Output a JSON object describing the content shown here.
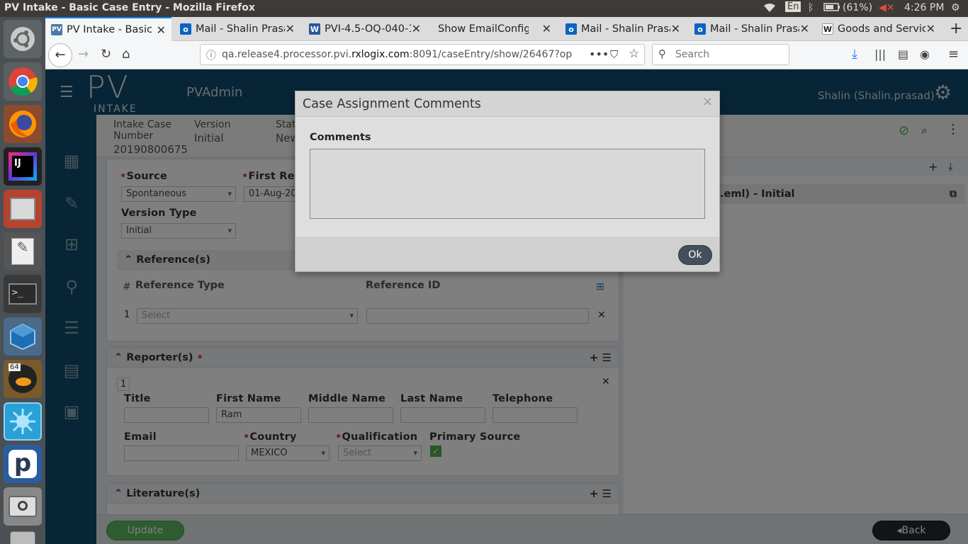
{
  "os": {
    "window_title": "PV Intake - Basic Case Entry - Mozilla Firefox",
    "keyboard": "En",
    "battery": "(61%)",
    "clock": "4:26 PM"
  },
  "launcher": {
    "items": [
      "ubuntu-home",
      "chrome",
      "firefox",
      "intellij",
      "file-manager",
      "text-editor",
      "terminal",
      "virtualbox",
      "game-64",
      "app-blue",
      "pidgin-p",
      "screenshot",
      "drive"
    ]
  },
  "browser": {
    "tabs": [
      {
        "label": "PV Intake - Basic C",
        "icon": "PV"
      },
      {
        "label": "Mail - Shalin Prasa",
        "icon": "o"
      },
      {
        "label": "PVI-4.5-OQ-040-1.",
        "icon": "W"
      },
      {
        "label": "Show EmailConfig",
        "icon": ""
      },
      {
        "label": "Mail - Shalin Prasa",
        "icon": "o"
      },
      {
        "label": "Mail - Shalin Prasa",
        "icon": "o"
      },
      {
        "label": "Goods and Servic",
        "icon": "W"
      }
    ],
    "url_prefix": "qa.release4.processor.pvi.",
    "url_domain": "rxlogix.com",
    "url_suffix": ":8091/caseEntry/show/26467?op",
    "search_placeholder": "Search"
  },
  "app": {
    "logo_big": "PV",
    "logo_small": "INTAKE",
    "module": "PVAdmin",
    "user": "Shalin (Shalin.prasad)",
    "case": {
      "number_label": "Intake Case Number",
      "number": "20190800675",
      "version_label": "Version",
      "version": "Initial",
      "status_label": "Stat",
      "status": "New"
    },
    "form": {
      "source_label": "Source",
      "source_value": "Spontaneous",
      "first_rec_label": "First Rec",
      "first_rec_value": "01-Aug-20",
      "version_type_label": "Version Type",
      "version_type_value": "Initial",
      "references": {
        "title": "Reference(s)",
        "col_hash": "#",
        "col_type": "Reference Type",
        "col_id": "Reference ID",
        "row_num": "1",
        "type_placeholder": "Select"
      },
      "reporters": {
        "title": "Reporter(s)",
        "row_num": "1",
        "title_label": "Title",
        "first_name_label": "First Name",
        "first_name": "Ram",
        "middle_name_label": "Middle Name",
        "last_name_label": "Last Name",
        "telephone_label": "Telephone",
        "email_label": "Email",
        "country_label": "Country",
        "country": "MEXICO",
        "qualification_label": "Qualification",
        "qualification": "Select",
        "primary_source_label": "Primary Source"
      },
      "literature": {
        "title": "Literature(s)"
      }
    },
    "right_panel": {
      "doc": ".eml) - Initial"
    },
    "footer": {
      "update": "Update",
      "back": "Back"
    }
  },
  "modal": {
    "title": "Case Assignment Comments",
    "close": "×",
    "comments_label": "Comments",
    "comments_value": "",
    "ok": "Ok"
  }
}
